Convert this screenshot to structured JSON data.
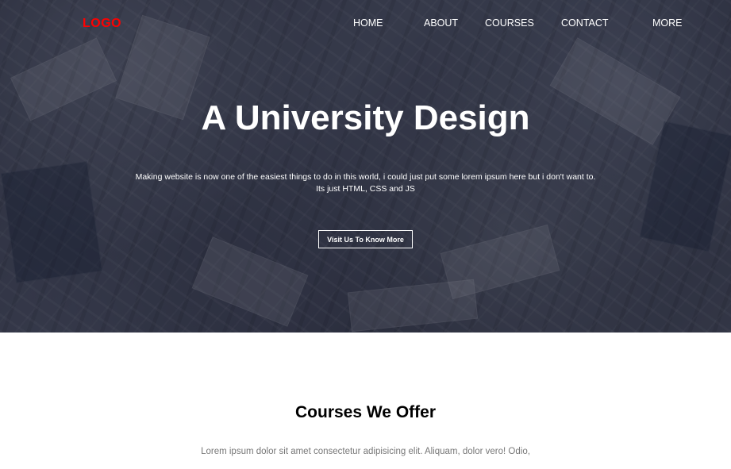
{
  "header": {
    "logo": "LOGO",
    "nav": [
      "HOME",
      "ABOUT",
      "COURSES",
      "CONTACT",
      "MORE"
    ]
  },
  "hero": {
    "title": "A University Design",
    "text_line1": "Making website is now one of the easiest things to do in this world, i could just put some lorem ipsum here but i don't want to.",
    "text_line2": "Its just HTML, CSS and JS",
    "button": "Visit Us To Know More"
  },
  "courses": {
    "title": "Courses We Offer",
    "text": "Lorem ipsum dolor sit amet consectetur adipisicing elit. Aliquam, dolor vero! Odio,"
  },
  "colors": {
    "logo": "#ff0000",
    "hero_overlay": "#1a1d2e",
    "text_light": "#ffffff",
    "muted_text": "#777777"
  }
}
